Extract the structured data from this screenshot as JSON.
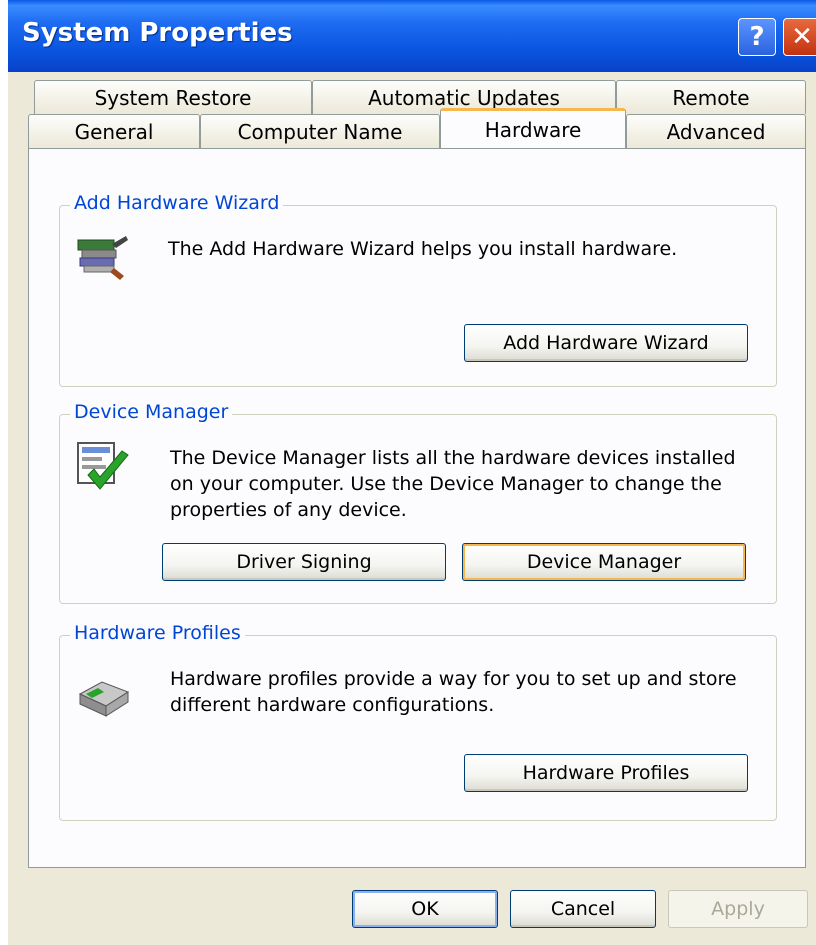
{
  "window": {
    "title": "System Properties"
  },
  "titlebar": {
    "help_glyph": "?",
    "close_glyph": "✕"
  },
  "tabs": {
    "row1": [
      "System Restore",
      "Automatic Updates",
      "Remote"
    ],
    "row2": [
      "General",
      "Computer Name",
      "Hardware",
      "Advanced"
    ],
    "active": "Hardware"
  },
  "groups": {
    "add_hardware": {
      "legend": "Add Hardware Wizard",
      "text": "The Add Hardware Wizard helps you install hardware.",
      "button": "Add Hardware Wizard",
      "icon": "add-hardware-icon"
    },
    "device_manager": {
      "legend": "Device Manager",
      "text_lines": [
        "The Device Manager lists all the hardware devices installed",
        "on your computer. Use the Device Manager to change the",
        "properties of any device."
      ],
      "button_signing": "Driver Signing",
      "button_manager": "Device Manager",
      "icon": "device-manager-icon"
    },
    "hardware_profiles": {
      "legend": "Hardware Profiles",
      "text_lines": [
        "Hardware profiles provide a way for you to set up and store",
        "different hardware configurations."
      ],
      "button": "Hardware Profiles",
      "icon": "hardware-profiles-icon"
    }
  },
  "footer": {
    "ok": "OK",
    "cancel": "Cancel",
    "apply": "Apply"
  },
  "colors": {
    "titlebar": "#0a55e0",
    "accent_tab": "#f5b84e",
    "legend": "#0046d5"
  }
}
